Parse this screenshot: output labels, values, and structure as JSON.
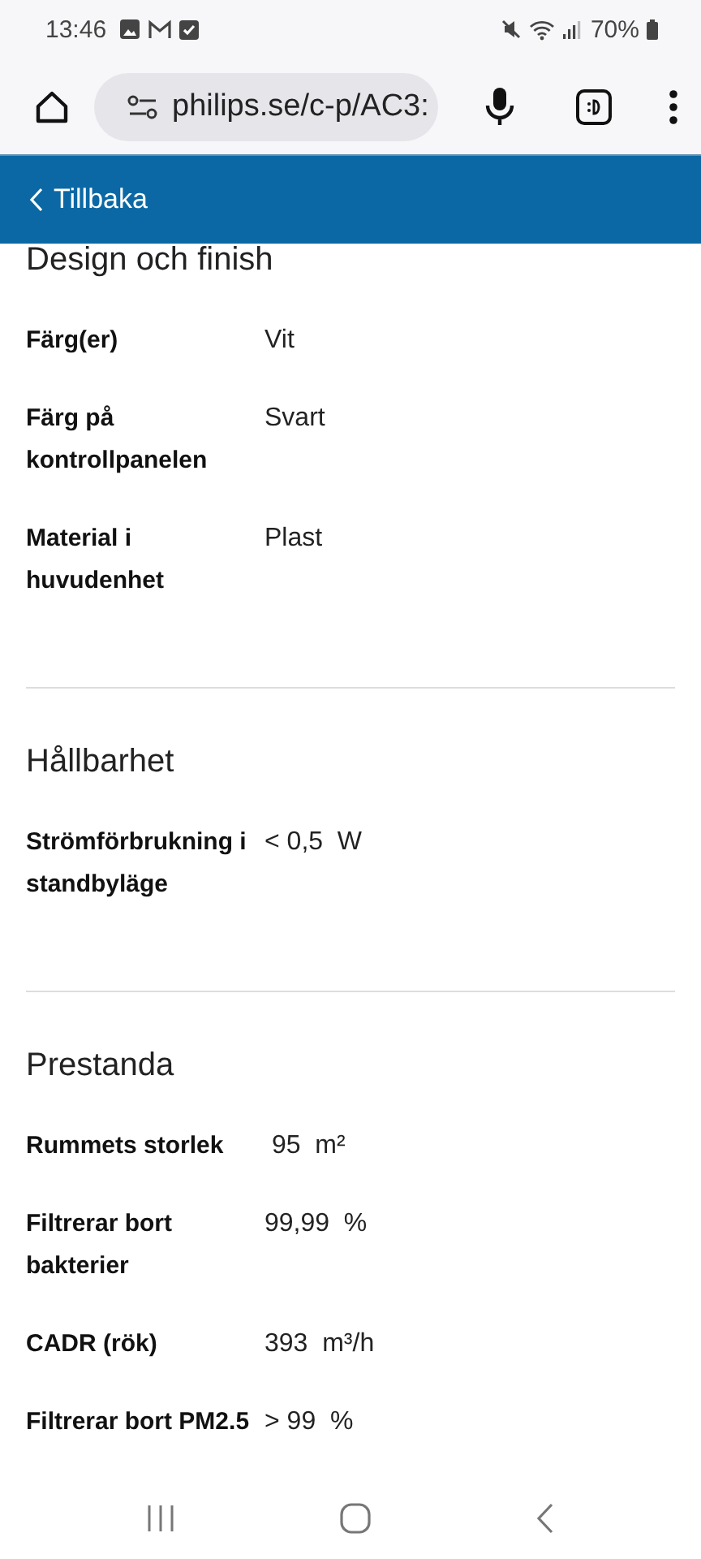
{
  "status_bar": {
    "time": "13:46",
    "battery": "70%"
  },
  "browser": {
    "url": "philips.se/c-p/AC3:"
  },
  "header": {
    "back_label": "Tillbaka"
  },
  "sections": [
    {
      "title": "Design och finish",
      "rows": [
        {
          "label": "Färg(er)",
          "value": "Vit"
        },
        {
          "label": "Färg på kontrollpanelen",
          "value": "Svart"
        },
        {
          "label": "Material i huvudenhet",
          "value": "Plast"
        }
      ]
    },
    {
      "title": "Hållbarhet",
      "rows": [
        {
          "label": "Strömförbrukning i standbyläge",
          "value": "< 0,5  W"
        }
      ]
    },
    {
      "title": "Prestanda",
      "rows": [
        {
          "label": "Rummets storlek",
          "value": " 95  m²"
        },
        {
          "label": "Filtrerar bort bakterier",
          "value": "99,99  %"
        },
        {
          "label": "CADR (rök)",
          "value": "393  m³/h"
        },
        {
          "label": "Filtrerar bort PM2.5",
          "value": "> 99  %"
        }
      ]
    }
  ]
}
